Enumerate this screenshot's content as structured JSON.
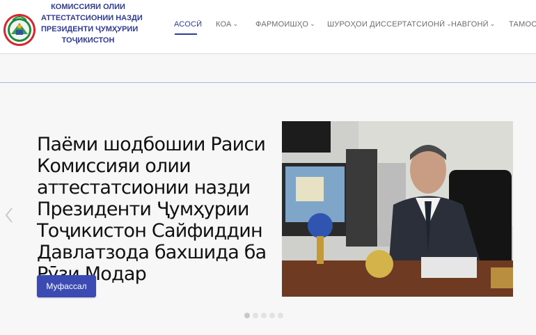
{
  "header": {
    "title_lines": [
      "КОМИССИЯИ ОЛИИ",
      "АТТЕСТАТСИОНИИ НАЗДИ",
      "ПРЕЗИДЕНТИ ҶУМҲУРИИ",
      "ТОҶИКИСТОН"
    ],
    "nav": [
      {
        "label": "АСОСӢ",
        "dropdown": false,
        "active": true
      },
      {
        "label": "КОА",
        "dropdown": true,
        "active": false
      },
      {
        "label": "ФАРМОИШҲО",
        "dropdown": true,
        "active": false
      },
      {
        "label": "ШУРОҲОИ ДИССЕРТАТСИОНӢ",
        "dropdown": true,
        "active": false
      },
      {
        "label": "НАВГОНӢ",
        "dropdown": true,
        "active": false
      },
      {
        "label": "ТАМОС",
        "dropdown": false,
        "active": false
      }
    ]
  },
  "slider": {
    "headline": "Паёми шодбошии Раиси Комиссияи олии аттестатсионии назди Президенти Ҷумҳурии Тоҷикистон Сайфиддин Давлатзода бахшида ба Рӯзи Модар",
    "button_label": "Муфассал",
    "slide_count": 5,
    "active_slide": 1
  },
  "colors": {
    "brand": "#2f3b97",
    "button": "#3b4bb3",
    "nav_text": "#6b6b6b",
    "background": "#f7f7f7"
  }
}
